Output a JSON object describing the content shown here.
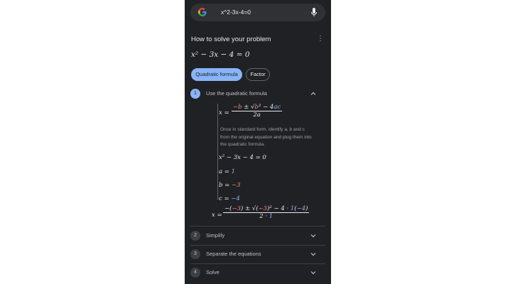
{
  "search": {
    "query": "x^2-3x-4=0"
  },
  "header": {
    "title": "How to solve your problem"
  },
  "problem": {
    "equation": "x² − 3x − 4 = 0"
  },
  "chips": [
    {
      "label": "Quadratic formula",
      "active": true
    },
    {
      "label": "Factor",
      "active": false
    }
  ],
  "steps": [
    {
      "num": "1",
      "label": "Use the quadratic formula",
      "expanded": true
    },
    {
      "num": "2",
      "label": "Simplify",
      "expanded": false
    },
    {
      "num": "3",
      "label": "Separate the equations",
      "expanded": false
    },
    {
      "num": "4",
      "label": "Solve",
      "expanded": false
    }
  ],
  "step1": {
    "formula_lhs": "x =",
    "formula_num_neg_b": "−b",
    "formula_num_pm": "±",
    "formula_num_root": "√",
    "formula_num_b2": "b",
    "formula_num_rest": "− 4",
    "formula_num_a": "a",
    "formula_num_c": "c",
    "formula_den": "2a",
    "description": "Once in standard form, identify a, b and c from the original equation and plug them into the quadratic formula.",
    "equation": "x² − 3x − 4 = 0",
    "a_label": "a =",
    "a_value": "1",
    "b_label": "b =",
    "b_value": "−3",
    "c_label": "c =",
    "c_value": "−4",
    "sub_lhs": "x =",
    "sub_num_1": "−(",
    "sub_num_b": "−3",
    "sub_num_2": ") ± √(",
    "sub_num_b2": "−3",
    "sub_num_3": ")² − 4 · ",
    "sub_num_a": "1",
    "sub_num_4": "(",
    "sub_num_c": "−4",
    "sub_num_5": ")",
    "sub_den_1": "2 · ",
    "sub_den_a": "1"
  },
  "colors": {
    "background": "#202124",
    "accent": "#8ab4f8",
    "red": "#f28b82",
    "text": "#e8eaed"
  },
  "icons": {
    "logo": "google-logo",
    "mic": "mic-icon",
    "more": "more-vert-icon",
    "chevron": "chevron-icon"
  }
}
